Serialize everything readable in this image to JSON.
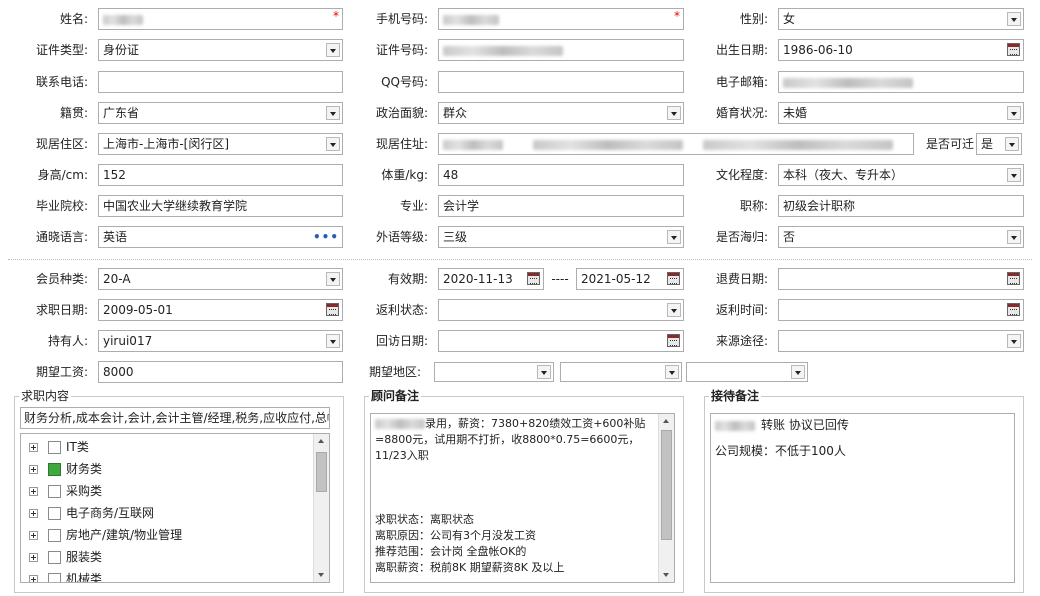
{
  "basic": {
    "name_label": "姓名:",
    "mobile_label": "手机号码:",
    "gender_label": "性别:",
    "gender_value": "女",
    "idtype_label": "证件类型:",
    "idtype_value": "身份证",
    "idno_label": "证件号码:",
    "birth_label": "出生日期:",
    "birth_value": "1986-06-10",
    "phone_label": "联系电话:",
    "qq_label": "QQ号码:",
    "email_label": "电子邮箱:",
    "native_label": "籍贯:",
    "native_value": "广东省",
    "political_label": "政治面貌:",
    "political_value": "群众",
    "marital_label": "婚育状况:",
    "marital_value": "未婚",
    "residence_label": "现居住区:",
    "residence_value": "上海市-上海市-[闵行区]",
    "address_label": "现居住址:",
    "relocate_label": "是否可迁",
    "relocate_value": "是",
    "height_label": "身高/cm:",
    "height_value": "152",
    "weight_label": "体重/kg:",
    "weight_value": "48",
    "education_label": "文化程度:",
    "education_value": "本科（夜大、专升本）",
    "school_label": "毕业院校:",
    "school_value": "中国农业大学继续教育学院",
    "major_label": "专业:",
    "major_value": "会计学",
    "title_label": "职称:",
    "title_value": "初级会计职称",
    "language_label": "通晓语言:",
    "language_value": "英语",
    "langlevel_label": "外语等级:",
    "langlevel_value": "三级",
    "overseas_label": "是否海归:",
    "overseas_value": "否"
  },
  "member": {
    "type_label": "会员种类:",
    "type_value": "20-A",
    "valid_label": "有效期:",
    "valid_from": "2020-11-13",
    "valid_sep": "----",
    "valid_to": "2021-05-12",
    "refund_label": "退费日期:",
    "jobdate_label": "求职日期:",
    "jobdate_value": "2009-05-01",
    "rebate_status_label": "返利状态:",
    "rebate_time_label": "返利时间:",
    "holder_label": "持有人:",
    "holder_value": "yirui017",
    "visit_label": "回访日期:",
    "source_label": "来源途径:",
    "salary_label": "期望工资:",
    "salary_value": "8000",
    "region_label": "期望地区:"
  },
  "job_panel": {
    "title": "求职内容",
    "summary": "财务分析,成本会计,会计,会计主管/经理,税务,应收应付,总帐",
    "tree": [
      {
        "label": "IT类",
        "checked": false
      },
      {
        "label": "财务类",
        "checked": true
      },
      {
        "label": "采购类",
        "checked": false
      },
      {
        "label": "电子商务/互联网",
        "checked": false
      },
      {
        "label": "房地产/建筑/物业管理",
        "checked": false
      },
      {
        "label": "服装类",
        "checked": false
      },
      {
        "label": "机械类",
        "checked": false
      }
    ]
  },
  "advisor_panel": {
    "title": "顾问备注",
    "line1": "录用，薪资：7380+820绩效工资+600补贴",
    "line2": "=8800元，试用期不打折，收8800*0.75=6600元，",
    "line3": "11/23入职",
    "line4": "求职状态：离职状态",
    "line5": "离职原因：公司有3个月没发工资",
    "line6": "推荐范围：会计岗 全盘帐OK的",
    "line7": "离职薪资：税前8K 期望薪资8K 及以上"
  },
  "reception_panel": {
    "title": "接待备注",
    "line1": "转账 协议已回传",
    "line2": "公司规模：不低于100人"
  }
}
